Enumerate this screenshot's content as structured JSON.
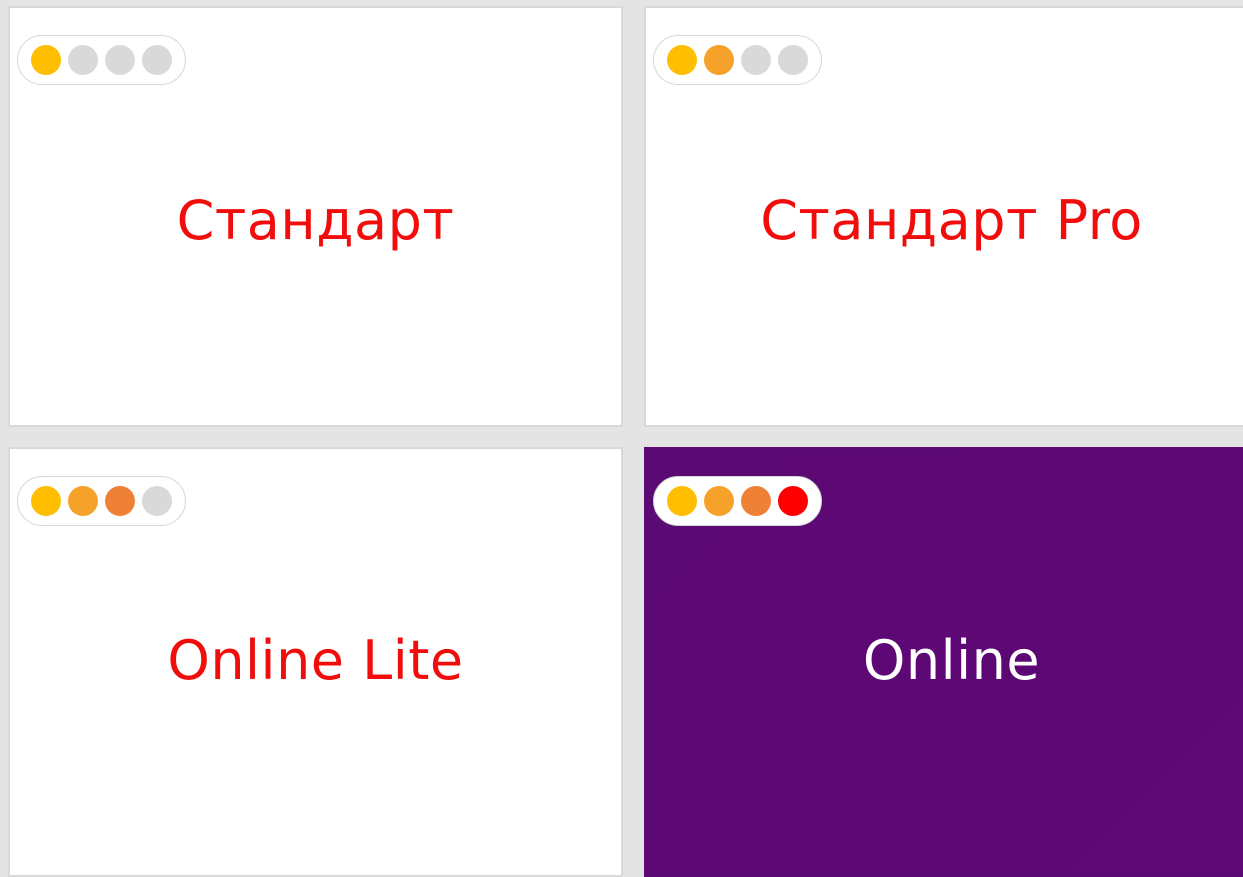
{
  "colors": {
    "background": "#e4e4e4",
    "card": "#ffffff",
    "card_border": "#d8d8d8",
    "accent_red": "#f20d0d",
    "featured": "#5c0a73",
    "dot_yellow": "#ffbf00",
    "dot_orange": "#f6a22a",
    "dot_dark_orange": "#ef8137",
    "dot_red": "#ff0000",
    "dot_empty": "#d9d9d9"
  },
  "cards": [
    {
      "title": "Стандарт",
      "rating_level": 1,
      "rating_max": 4,
      "dots": [
        "#ffbf00",
        "#d9d9d9",
        "#d9d9d9",
        "#d9d9d9"
      ],
      "featured": false
    },
    {
      "title": "Стандарт Pro",
      "rating_level": 2,
      "rating_max": 4,
      "dots": [
        "#ffbf00",
        "#f6a22a",
        "#d9d9d9",
        "#d9d9d9"
      ],
      "featured": false
    },
    {
      "title": "Online Lite",
      "rating_level": 3,
      "rating_max": 4,
      "dots": [
        "#ffbf00",
        "#f6a22a",
        "#ef8137",
        "#d9d9d9"
      ],
      "featured": false
    },
    {
      "title": "Online",
      "rating_level": 4,
      "rating_max": 4,
      "dots": [
        "#ffbf00",
        "#f6a22a",
        "#ef8137",
        "#ff0000"
      ],
      "featured": true,
      "background": "#5c0a73"
    }
  ]
}
